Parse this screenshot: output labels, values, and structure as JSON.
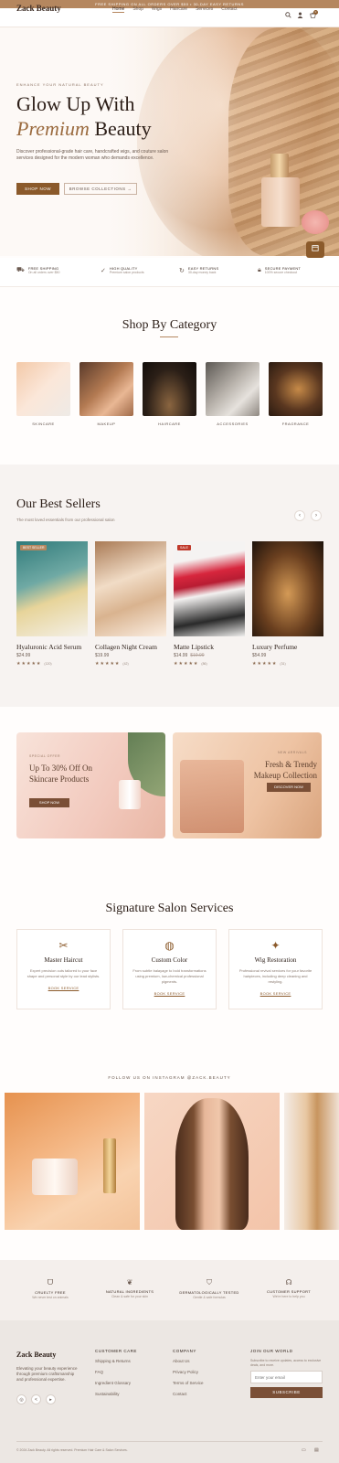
{
  "announcement": "FREE SHIPPING ON ALL ORDERS OVER $50 • 30-DAY EASY RETURNS",
  "header": {
    "logo": "Zack Beauty",
    "nav": [
      "Home",
      "Shop",
      "Wigs",
      "Haircare",
      "Services",
      "Contact"
    ],
    "cart_count": "0"
  },
  "hero": {
    "eyebrow": "ENHANCE YOUR NATURAL BEAUTY",
    "title_line1": "Glow Up With",
    "title_accent": "Premium",
    "title_rest": " Beauty",
    "description": "Discover professional-grade hair care, handcrafted wigs, and couture salon services designed for the modern woman who demands excellence.",
    "primary_cta": "SHOP NOW",
    "secondary_cta": "BROWSE COLLECTIONS →"
  },
  "features": [
    {
      "title": "FREE SHIPPING",
      "sub": "On all orders over $50",
      "icon": "truck-icon"
    },
    {
      "title": "HIGH QUALITY",
      "sub": "Premium salon products",
      "icon": "check-circle-icon"
    },
    {
      "title": "EASY RETURNS",
      "sub": "30-day money back",
      "icon": "return-icon"
    },
    {
      "title": "SECURE PAYMENT",
      "sub": "100% secure checkout",
      "icon": "lock-icon"
    }
  ],
  "categories": {
    "title": "Shop By Category",
    "items": [
      "SKINCARE",
      "MAKEUP",
      "HAIRCARE",
      "ACCESSORIES",
      "FRAGRANCE"
    ]
  },
  "bestsellers": {
    "title": "Our Best Sellers",
    "subtitle": "The most loved essentials from our professional salon",
    "products": [
      {
        "badge": "BEST SELLER",
        "name": "Hyaluronic Acid Serum",
        "price": "$24.99",
        "old_price": "",
        "stars": "★★★★★",
        "reviews": "(120)"
      },
      {
        "badge": "",
        "name": "Collagen Night Cream",
        "price": "$19.99",
        "old_price": "",
        "stars": "★★★★★",
        "reviews": "(42)"
      },
      {
        "badge": "SALE",
        "name": "Matte Lipstick",
        "price": "$14.99",
        "old_price": "$19.99",
        "stars": "★★★★★",
        "reviews": "(86)"
      },
      {
        "badge": "",
        "name": "Luxury Perfume",
        "price": "$54.99",
        "old_price": "",
        "stars": "★★★★★",
        "reviews": "(31)"
      }
    ]
  },
  "promos": [
    {
      "tag": "SPECIAL OFFER",
      "headline": "Up To 30% Off On Skincare Products",
      "cta": "SHOP NOW"
    },
    {
      "tag": "NEW ARRIVALS",
      "headline": "Fresh & Trendy Makeup Collection",
      "cta": "DISCOVER NOW"
    }
  ],
  "services": {
    "title": "Signature Salon Services",
    "items": [
      {
        "icon": "scissors-icon",
        "title": "Master Haircut",
        "desc": "Expert precision cuts tailored to your face shape and personal style by our lead stylists.",
        "cta": "BOOK SERVICE"
      },
      {
        "icon": "palette-icon",
        "title": "Custom Color",
        "desc": "From subtle balayage to bold transformations using premium, low-chemical professional pigments.",
        "cta": "BOOK SERVICE"
      },
      {
        "icon": "sparkle-icon",
        "title": "Wig Restoration",
        "desc": "Professional revival services for your favorite hairpieces, including deep cleaning and restyling.",
        "cta": "BOOK SERVICE"
      }
    ]
  },
  "instagram": {
    "title": "FOLLOW US ON INSTAGRAM @ZACK.BEAUTY"
  },
  "trust": [
    {
      "icon": "rabbit-icon",
      "title": "CRUELTY FREE",
      "sub": "We never test on animals"
    },
    {
      "icon": "leaf-icon",
      "title": "NATURAL INGREDIENTS",
      "sub": "Clean & safe for your skin"
    },
    {
      "icon": "shield-icon",
      "title": "DERMATOLOGICALLY TESTED",
      "sub": "Gentle & safe formulas"
    },
    {
      "icon": "headset-icon",
      "title": "CUSTOMER SUPPORT",
      "sub": "We're here to help you"
    }
  ],
  "footer": {
    "logo": "Zack Beauty",
    "description": "Elevating your beauty experience through premium craftsmanship and professional expertise.",
    "columns": [
      {
        "heading": "CUSTOMER CARE",
        "items": [
          "Shipping & Returns",
          "FAQ",
          "Ingredient Glossary",
          "Sustainability"
        ]
      },
      {
        "heading": "COMPANY",
        "items": [
          "About Us",
          "Privacy Policy",
          "Terms of Service",
          "Contact"
        ]
      }
    ],
    "newsletter_heading": "JOIN OUR WORLD",
    "newsletter_desc": "Subscribe to receive updates, access to exclusive deals, and more.",
    "email_placeholder": "Enter your email",
    "subscribe": "SUBSCRIBE",
    "copyright": "© 2024 Zack Beauty. All rights reserved. Premium Hair Care & Salon Services."
  },
  "colors": {
    "accent": "#8b5a2b",
    "gold": "#b5875f",
    "dark": "#2c1e17"
  }
}
